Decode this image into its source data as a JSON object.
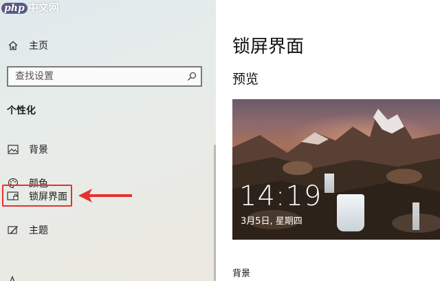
{
  "watermark": {
    "prefix": "php",
    "suffix": "中文网"
  },
  "sidebar": {
    "home_label": "主页",
    "search_placeholder": "查找设置",
    "section_title": "个性化",
    "items": [
      {
        "label": "背景",
        "icon": "image-icon"
      },
      {
        "label": "颜色",
        "icon": "palette-icon"
      },
      {
        "label": "锁屏界面",
        "icon": "lock-screen-icon",
        "selected": true
      },
      {
        "label": "主题",
        "icon": "theme-icon"
      },
      {
        "label": "",
        "icon": "font-icon"
      }
    ]
  },
  "main": {
    "title": "锁屏界面",
    "preview_heading": "预览",
    "preview": {
      "time": "14:19",
      "date": "3月5日, 星期四"
    },
    "background_label": "背景"
  },
  "colors": {
    "annotation_red": "#e8302c",
    "sidebar_bg": "#e3ebeb",
    "text": "#1a1a1a"
  }
}
